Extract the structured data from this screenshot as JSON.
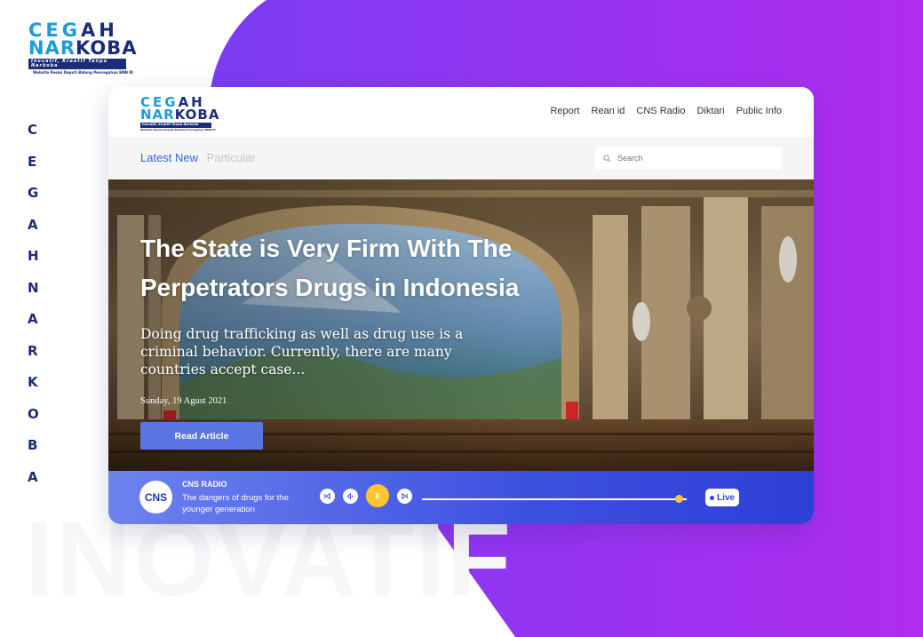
{
  "brand": {
    "logo_line1_a": "CEG",
    "logo_line1_b": "AH",
    "logo_line2_a": "NAR",
    "logo_line2_b": "KOBA",
    "tagline": "Inovatif, Kreatif Tanpa Narkoba",
    "subline": "Website Resmi Deputi Bidang Pencegahan BNN RI"
  },
  "side_letters": [
    "C",
    "E",
    "G",
    "A",
    "H",
    "N",
    "A",
    "R",
    "K",
    "O",
    "B",
    "A"
  ],
  "watermark": "INOVATIF",
  "nav": {
    "items": [
      "Report",
      "Rean id",
      "CNS Radio",
      "Diktari",
      "Public Info"
    ]
  },
  "tabs": {
    "active": "Latest New",
    "inactive": "Particular"
  },
  "search": {
    "placeholder": "Search"
  },
  "hero": {
    "title": "The State is Very Firm With The Perpetrators Drugs in Indonesia",
    "description": "Doing drug trafficking as well as drug use is a criminal behavior. Currently, there are many countries accept case...",
    "date": "Sunday, 19 Agust 2021",
    "button": "Read Article"
  },
  "radio": {
    "logo": "CNS",
    "title": "CNS RADIO",
    "subtitle": "The dangers of drugs for the younger generation",
    "progress": 0.97,
    "live_label": "Live",
    "controls": {
      "prev": "⏮",
      "back": "◁•",
      "pause": "II",
      "next": "▷"
    }
  },
  "colors": {
    "accent": "#3563d9",
    "purple_bg": "#a13cf0",
    "button": "#5a75e3",
    "play": "#ffc62e"
  },
  "icons": [
    "search-icon",
    "prev-icon",
    "rewind-icon",
    "pause-icon",
    "next-icon",
    "live-dot-icon"
  ]
}
